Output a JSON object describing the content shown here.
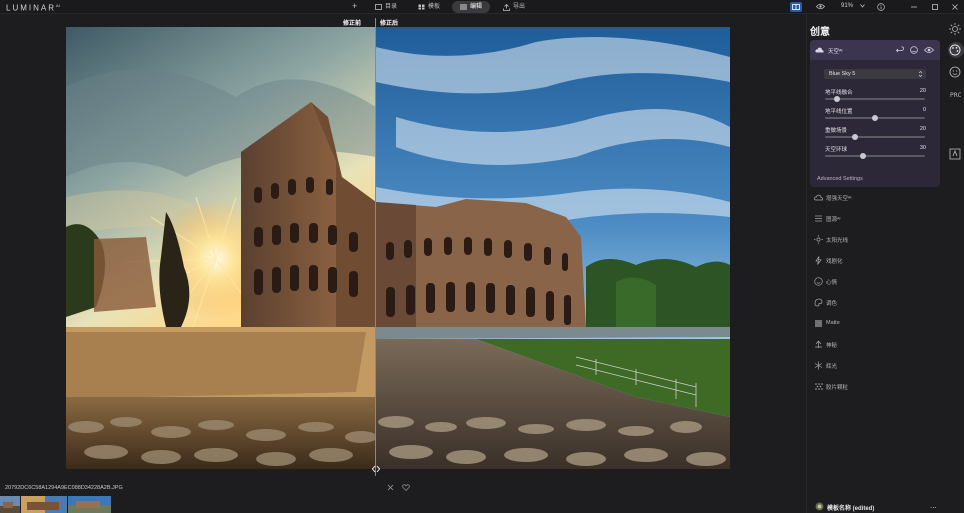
{
  "app": {
    "logo": "LUMINAR",
    "logo_version": "AI"
  },
  "topbar": {
    "add_label": "+",
    "catalog_label": "目录",
    "templates_label": "模板",
    "edit_label": "编辑",
    "export_label": "导出",
    "zoom": "91%"
  },
  "canvas": {
    "before_label": "修正前",
    "after_label": "修正后"
  },
  "filmstrip": {
    "filename": "20792DC6C58A1294A9EC088D34228A2B.JPG",
    "thumbnail_count": 3
  },
  "panel": {
    "title": "创意",
    "sky": {
      "title": "天空ᴬᴵ",
      "selected_sky": "Blue Sky 5",
      "sliders": [
        {
          "label": "地平线融合",
          "value": "20",
          "fraction": 0.12
        },
        {
          "label": "地平线位置",
          "value": "0",
          "fraction": 0.5
        },
        {
          "label": "重做场景",
          "value": "20",
          "fraction": 0.3
        },
        {
          "label": "天空环球",
          "value": "30",
          "fraction": 0.38
        }
      ],
      "advanced_label": "Advanced Settings"
    },
    "tools": [
      {
        "label": "增强天空ᴬᴵ",
        "icon": "cloud-icon"
      },
      {
        "label": "图源ᴬᴵ",
        "icon": "layers-icon"
      },
      {
        "label": "太阳光线",
        "icon": "sun-rays-icon"
      },
      {
        "label": "戏剧化",
        "icon": "bolt-icon"
      },
      {
        "label": "心情",
        "icon": "mood-icon"
      },
      {
        "label": "调色",
        "icon": "palette-icon"
      },
      {
        "label": "Matte",
        "icon": "matte-icon"
      },
      {
        "label": "神秘",
        "icon": "mystic-icon"
      },
      {
        "label": "辉光",
        "icon": "glow-icon"
      },
      {
        "label": "胶片颗粒",
        "icon": "grain-icon"
      }
    ],
    "preset": {
      "name": "模板名称 (edited)",
      "more": "..."
    }
  },
  "colors": {
    "accent": "#3aa2d8",
    "panel_bg": "#1d1d1f",
    "card_bg": "#2c2838",
    "card_header": "#3b3550"
  }
}
